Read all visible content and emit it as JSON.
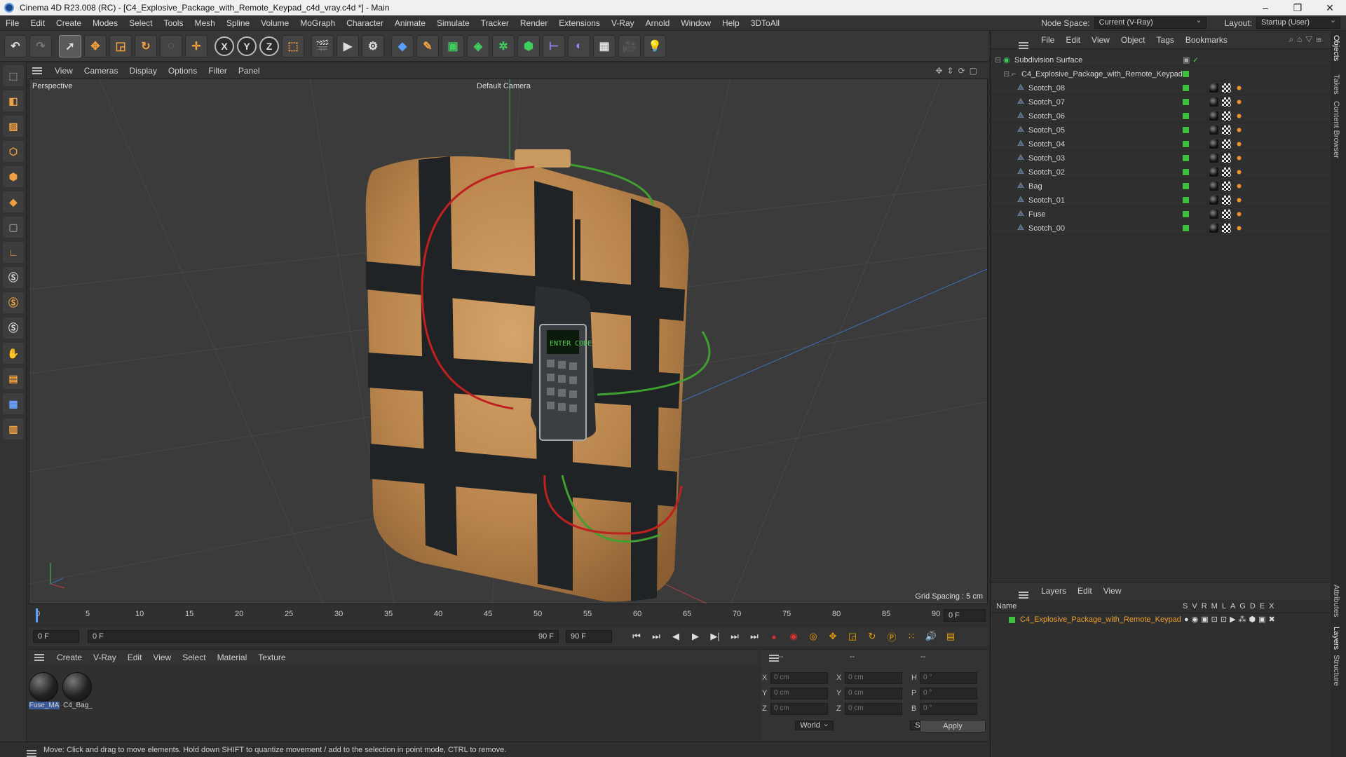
{
  "titlebar": {
    "title": "Cinema 4D R23.008 (RC) - [C4_Explosive_Package_with_Remote_Keypad_c4d_vray.c4d *] - Main"
  },
  "menubar": {
    "items": [
      "File",
      "Edit",
      "Create",
      "Modes",
      "Select",
      "Tools",
      "Mesh",
      "Spline",
      "Volume",
      "MoGraph",
      "Character",
      "Animate",
      "Simulate",
      "Tracker",
      "Render",
      "Extensions",
      "V-Ray",
      "Arnold",
      "Window",
      "Help",
      "3DToAll"
    ],
    "node_space_label": "Node Space:",
    "node_space_value": "Current (V-Ray)",
    "layout_label": "Layout:",
    "layout_value": "Startup (User)"
  },
  "toolbar": {
    "x_label": "X",
    "y_label": "Y",
    "z_label": "Z"
  },
  "viewport": {
    "menu": [
      "View",
      "Cameras",
      "Display",
      "Options",
      "Filter",
      "Panel"
    ],
    "projection": "Perspective",
    "camera": "Default Camera",
    "grid_spacing": "Grid Spacing : 5 cm",
    "keypad_display": "ENTER CODE"
  },
  "timeline": {
    "ticks": [
      "0",
      "5",
      "10",
      "15",
      "20",
      "25",
      "30",
      "35",
      "40",
      "45",
      "50",
      "55",
      "60",
      "65",
      "70",
      "75",
      "80",
      "85",
      "90"
    ],
    "current_frame": "0 F",
    "start_frame": "0 F",
    "range_start": "0 F",
    "range_end": "90 F",
    "end_frame": "90 F"
  },
  "materials": {
    "menu": [
      "Create",
      "V-Ray",
      "Edit",
      "View",
      "Select",
      "Material",
      "Texture"
    ],
    "items": [
      "Fuse_MA",
      "C4_Bag_"
    ]
  },
  "coordinates": {
    "header": [
      "--",
      "--",
      "--"
    ],
    "pos_labels": [
      "X",
      "Y",
      "Z"
    ],
    "pos_values": [
      "0 cm",
      "0 cm",
      "0 cm"
    ],
    "size_labels": [
      "X",
      "Y",
      "Z"
    ],
    "size_values": [
      "0 cm",
      "0 cm",
      "0 cm"
    ],
    "rot_labels": [
      "H",
      "P",
      "B"
    ],
    "rot_values": [
      "0 °",
      "0 °",
      "0 °"
    ],
    "mode": "World",
    "scale_mode": "Scale",
    "apply": "Apply"
  },
  "status": {
    "text": "Move: Click and drag to move elements. Hold down SHIFT to quantize movement / add to the selection in point mode, CTRL to remove."
  },
  "objects": {
    "menu": [
      "File",
      "Edit",
      "View",
      "Object",
      "Tags",
      "Bookmarks"
    ],
    "root": "Subdivision Surface",
    "group": "C4_Explosive_Package_with_Remote_Keypad",
    "children": [
      "Scotch_08",
      "Scotch_07",
      "Scotch_06",
      "Scotch_05",
      "Scotch_04",
      "Scotch_03",
      "Scotch_02",
      "Bag",
      "Scotch_01",
      "Fuse",
      "Scotch_00"
    ]
  },
  "layers": {
    "menu": [
      "Layers",
      "Edit",
      "View"
    ],
    "name_header": "Name",
    "flags": [
      "S",
      "V",
      "R",
      "M",
      "L",
      "A",
      "G",
      "D",
      "E",
      "X"
    ],
    "items": [
      "C4_Explosive_Package_with_Remote_Keypad"
    ],
    "accent": "#f0a030"
  },
  "side_tabs": [
    "Objects",
    "Takes",
    "Content Browser",
    "Attributes",
    "Layers",
    "Structure"
  ]
}
